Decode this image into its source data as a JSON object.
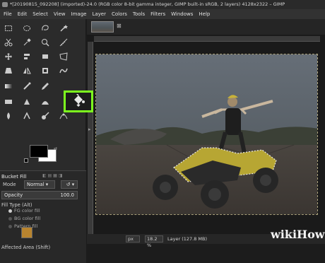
{
  "window": {
    "title": "*[20190815_092208] (imported)-24.0 (RGB color 8-bit gamma integer, GIMP built-in sRGB, 2 layers) 4128x2322 – GIMP"
  },
  "menu": [
    "File",
    "Edit",
    "Select",
    "View",
    "Image",
    "Layer",
    "Colors",
    "Tools",
    "Filters",
    "Windows",
    "Help"
  ],
  "tool_options": {
    "title": "Bucket Fill",
    "mode_label": "Mode",
    "mode_value": "Normal",
    "opacity_label": "Opacity",
    "opacity_value": "100.0",
    "fill_type_label": "Fill Type  (Alt)",
    "fill_options": [
      "FG color fill",
      "BG color fill",
      "Pattern fill"
    ],
    "selected_fill": "FG color fill",
    "affected_area_label": "Affected Area  (Shift)"
  },
  "status": {
    "unit": "px",
    "zoom": "18.2 %",
    "info": "Layer (127.8 MB)"
  },
  "highlight_color": "#7dff1e",
  "watermark": {
    "wiki": "wiki",
    "how": "How"
  },
  "icons": [
    "app-icon",
    "rect-select-icon",
    "ellipse-select-icon",
    "lasso-icon",
    "fuzzy-select-icon",
    "scissors-icon",
    "color-picker-icon",
    "zoom-icon",
    "measure-icon",
    "move-icon",
    "align-icon",
    "transform-icon",
    "unified-transform-icon",
    "perspective-icon",
    "flip-icon",
    "cage-icon",
    "warp-icon",
    "bucket-fill-icon",
    "gradient-icon",
    "paintbrush-icon",
    "pencil-icon",
    "airbrush-icon",
    "ink-icon",
    "clone-icon",
    "heal-icon",
    "smudge-icon",
    "dodge-icon",
    "path-icon",
    "text-icon"
  ]
}
